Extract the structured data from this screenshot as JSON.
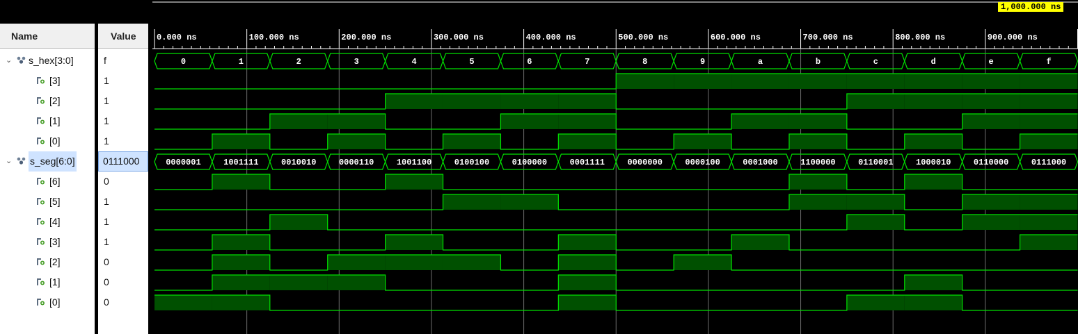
{
  "columns": {
    "name": "Name",
    "value": "Value"
  },
  "cursor": {
    "label": "1,000.000 ns"
  },
  "timeline": {
    "labels": [
      "0.000 ns",
      "100.000 ns",
      "200.000 ns",
      "300.000 ns",
      "400.000 ns",
      "500.000 ns",
      "600.000 ns",
      "700.000 ns",
      "800.000 ns",
      "900.000 ns"
    ],
    "step_ns": 62.5
  },
  "signals": [
    {
      "name": "s_hex[3:0]",
      "value": "f",
      "type": "bus",
      "expanded": true,
      "values": [
        "0",
        "1",
        "2",
        "3",
        "4",
        "5",
        "6",
        "7",
        "8",
        "9",
        "a",
        "b",
        "c",
        "d",
        "e",
        "f"
      ]
    },
    {
      "name": "[3]",
      "value": "1",
      "type": "bit",
      "bits": [
        0,
        0,
        0,
        0,
        0,
        0,
        0,
        0,
        1,
        1,
        1,
        1,
        1,
        1,
        1,
        1
      ]
    },
    {
      "name": "[2]",
      "value": "1",
      "type": "bit",
      "bits": [
        0,
        0,
        0,
        0,
        1,
        1,
        1,
        1,
        0,
        0,
        0,
        0,
        1,
        1,
        1,
        1
      ]
    },
    {
      "name": "[1]",
      "value": "1",
      "type": "bit",
      "bits": [
        0,
        0,
        1,
        1,
        0,
        0,
        1,
        1,
        0,
        0,
        1,
        1,
        0,
        0,
        1,
        1
      ]
    },
    {
      "name": "[0]",
      "value": "1",
      "type": "bit",
      "bits": [
        0,
        1,
        0,
        1,
        0,
        1,
        0,
        1,
        0,
        1,
        0,
        1,
        0,
        1,
        0,
        1
      ]
    },
    {
      "name": "s_seg[6:0]",
      "value": "0111000",
      "type": "bus",
      "expanded": true,
      "selected": true,
      "values": [
        "0000001",
        "1001111",
        "0010010",
        "0000110",
        "1001100",
        "0100100",
        "0100000",
        "0001111",
        "0000000",
        "0000100",
        "0001000",
        "1100000",
        "0110001",
        "1000010",
        "0110000",
        "0111000"
      ]
    },
    {
      "name": "[6]",
      "value": "0",
      "type": "bit",
      "bits": [
        0,
        1,
        0,
        0,
        1,
        0,
        0,
        0,
        0,
        0,
        0,
        1,
        0,
        1,
        0,
        0
      ]
    },
    {
      "name": "[5]",
      "value": "1",
      "type": "bit",
      "bits": [
        0,
        0,
        0,
        0,
        0,
        1,
        1,
        0,
        0,
        0,
        0,
        1,
        1,
        0,
        1,
        1
      ]
    },
    {
      "name": "[4]",
      "value": "1",
      "type": "bit",
      "bits": [
        0,
        0,
        1,
        0,
        0,
        0,
        0,
        0,
        0,
        0,
        0,
        0,
        1,
        0,
        1,
        1
      ]
    },
    {
      "name": "[3]",
      "value": "1",
      "type": "bit",
      "bits": [
        0,
        1,
        0,
        0,
        1,
        0,
        0,
        1,
        0,
        0,
        1,
        0,
        0,
        0,
        0,
        1
      ]
    },
    {
      "name": "[2]",
      "value": "0",
      "type": "bit",
      "bits": [
        0,
        1,
        0,
        1,
        1,
        1,
        0,
        1,
        0,
        1,
        0,
        0,
        0,
        0,
        0,
        0
      ]
    },
    {
      "name": "[1]",
      "value": "0",
      "type": "bit",
      "bits": [
        0,
        1,
        1,
        1,
        0,
        0,
        0,
        1,
        0,
        0,
        0,
        0,
        0,
        1,
        0,
        0
      ]
    },
    {
      "name": "[0]",
      "value": "0",
      "type": "bit",
      "bits": [
        1,
        1,
        0,
        0,
        0,
        0,
        0,
        1,
        0,
        0,
        0,
        0,
        1,
        1,
        0,
        0
      ]
    }
  ],
  "colors": {
    "wave": "#00e000",
    "fill": "#005000",
    "grid": "#8a8a8a",
    "cursor_bg": "#ffff00",
    "selected_bg": "#cfe3ff"
  }
}
